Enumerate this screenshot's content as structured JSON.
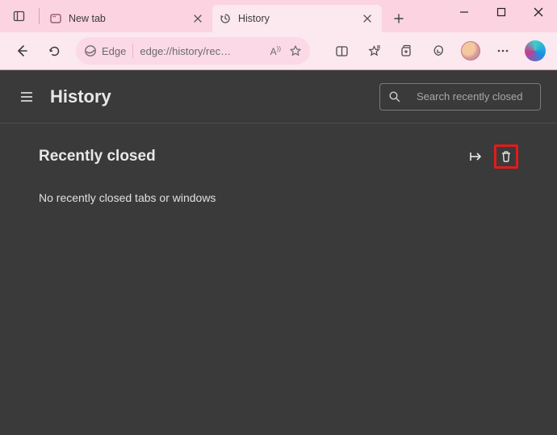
{
  "window": {
    "tabs": [
      {
        "title": "New tab",
        "icon": "newtab"
      },
      {
        "title": "History",
        "icon": "history"
      }
    ],
    "active_tab_index": 1
  },
  "toolbar": {
    "edge_label": "Edge",
    "url_display": "edge://history/rec…",
    "read_aloud_label": "Aᴺ"
  },
  "history_page": {
    "title": "History",
    "search_placeholder": "Search recently closed",
    "section_title": "Recently closed",
    "empty_message": "No recently closed tabs or windows"
  }
}
